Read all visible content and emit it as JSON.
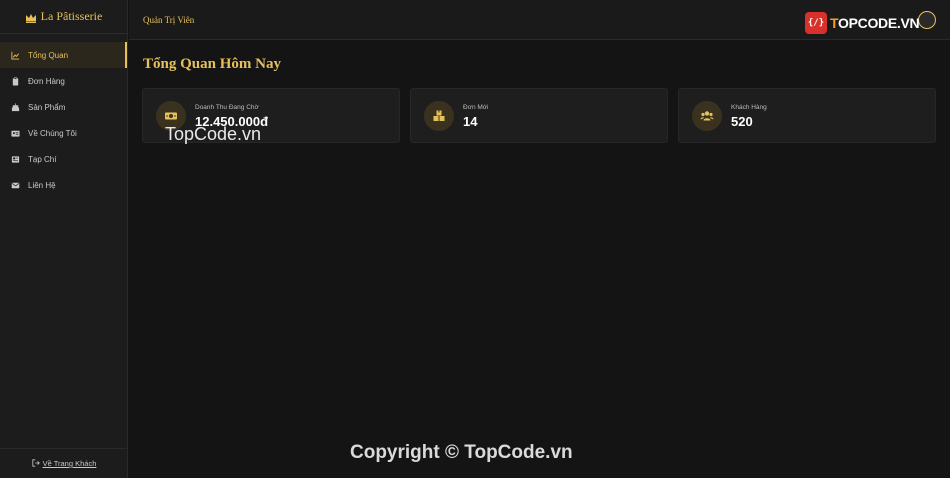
{
  "brand": {
    "name": "La Pâtisserie",
    "icon": "crown-icon"
  },
  "sidebar": {
    "items": [
      {
        "label": "Tổng Quan",
        "icon": "chart-line-icon",
        "active": true
      },
      {
        "label": "Đơn Hàng",
        "icon": "clipboard-icon",
        "active": false
      },
      {
        "label": "Sản Phẩm",
        "icon": "cake-icon",
        "active": false
      },
      {
        "label": "Về Chúng Tôi",
        "icon": "id-card-icon",
        "active": false
      },
      {
        "label": "Tạp Chí",
        "icon": "newspaper-icon",
        "active": false
      },
      {
        "label": "Liên Hệ",
        "icon": "envelope-icon",
        "active": false
      }
    ],
    "footer": {
      "label": "Về Trang Khách",
      "icon": "sign-out-icon"
    }
  },
  "header": {
    "title": "Quản Trị Viên"
  },
  "main": {
    "title": "Tổng Quan Hôm Nay",
    "stats": [
      {
        "label": "Doanh Thu Đang Chờ",
        "value": "12.450.000đ",
        "icon": "money-bill-icon"
      },
      {
        "label": "Đơn Mới",
        "value": "14",
        "icon": "boxes-icon"
      },
      {
        "label": "Khách Hàng",
        "value": "520",
        "icon": "users-icon"
      }
    ]
  },
  "watermark": {
    "logo_brace": "{/}",
    "logo_text_a": "T",
    "logo_text_b": "OPCODE.VN",
    "overlay": "TopCode.vn",
    "copyright": "Copyright © TopCode.vn"
  },
  "colors": {
    "accent": "#e6c15a",
    "background": "#141414",
    "sidebar": "#1c1c1c",
    "card": "#1e1e1e"
  }
}
